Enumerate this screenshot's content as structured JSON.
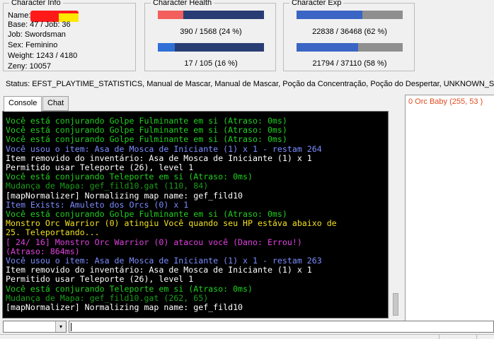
{
  "character_info": {
    "title": "Character Info",
    "name_label": "Name:",
    "base_job": "Base: 47 / Job: 36",
    "job": "Job: Swordsman",
    "sex": "Sex: Feminino",
    "weight": "Weight: 1243 / 4180",
    "zeny": "Zeny: 10057"
  },
  "character_health": {
    "title": "Character Health",
    "hp_text": "390 / 1568 (24 %)",
    "hp_fraction": 0.24,
    "sp_text": "17 / 105 (16 %)",
    "sp_fraction": 0.16
  },
  "character_exp": {
    "title": "Character Exp",
    "base_text": "22838 / 36468 (62 %)",
    "base_fraction": 0.62,
    "job_text": "21794 / 37110 (58 %)",
    "job_fraction": 0.58
  },
  "colors": {
    "hp": "#f25f5c",
    "sp": "#2f6fd6",
    "exp": "#3a65c4",
    "bar_bg": "#293d75",
    "exp_bg": "#8f8f8f",
    "green": "#1fd11f",
    "cyan_blue": "#7c8cff",
    "white": "#ffffff",
    "yellow": "#f0e020",
    "magenta": "#e040e0",
    "dark_green": "#1a9c1a"
  },
  "status": "Status: EFST_PLAYTIME_STATISTICS, Manual de Mascar, Manual de Mascar, Poção da Concentração, Poção do Despertar, UNKNOWN_STA",
  "tabs": [
    {
      "label": "Console",
      "active": true
    },
    {
      "label": "Chat",
      "active": false
    }
  ],
  "console_lines": [
    {
      "text": "Você está conjurando Golpe Fulminante em si (Atraso: 0ms)",
      "color": "#1fd11f"
    },
    {
      "text": "Você está conjurando Golpe Fulminante em si (Atraso: 0ms)",
      "color": "#1fd11f"
    },
    {
      "text": "Você está conjurando Golpe Fulminante em si (Atraso: 0ms)",
      "color": "#1fd11f"
    },
    {
      "text": "Você usou o item: Asa de Mosca de Iniciante (1) x 1 - restam 264",
      "color": "#7c8cff"
    },
    {
      "text": "Item removido do inventário: Asa de Mosca de Iniciante (1) x 1",
      "color": "#ffffff"
    },
    {
      "text": "Permitido usar Teleporte (26), level 1",
      "color": "#ffffff"
    },
    {
      "text": "Você está conjurando Teleporte em si (Atraso: 0ms)",
      "color": "#1fd11f"
    },
    {
      "text": "Mudança de Mapa: gef_fild10.gat (110, 84)",
      "color": "#1a9c1a"
    },
    {
      "text": "[mapNormalizer] Normalizing map name: gef_fild10",
      "color": "#ffffff"
    },
    {
      "text": "Item Exists: Amuleto dos Orcs (0) x 1",
      "color": "#7c8cff"
    },
    {
      "text": "Você está conjurando Golpe Fulminante em si (Atraso: 0ms)",
      "color": "#1fd11f"
    },
    {
      "text": "Monstro Orc Warrior (0) atingiu Você quando seu HP estáva abaixo de",
      "color": "#f0e020"
    },
    {
      "text": "25. Teleportando...",
      "color": "#f0e020"
    },
    {
      "text": "[ 24/ 16] Monstro Orc Warrior (0) atacou você (Dano: Errou!)",
      "color": "#e040e0"
    },
    {
      "text": "(Atraso: 864ms)",
      "color": "#e040e0"
    },
    {
      "text": "Você usou o item: Asa de Mosca de Iniciante (1) x 1 - restam 263",
      "color": "#7c8cff"
    },
    {
      "text": "Item removido do inventário: Asa de Mosca de Iniciante (1) x 1",
      "color": "#ffffff"
    },
    {
      "text": "Permitido usar Teleporte (26), level 1",
      "color": "#ffffff"
    },
    {
      "text": "Você está conjurando Teleporte em si (Atraso: 0ms)",
      "color": "#1fd11f"
    },
    {
      "text": "Mudança de Mapa: gef_fild10.gat (262, 65)",
      "color": "#1a9c1a"
    },
    {
      "text": "[mapNormalizer] Normalizing map name: gef_fild10",
      "color": "#ffffff"
    }
  ],
  "monster_list": [
    {
      "text": "0   Orc Baby (255, 53 )"
    }
  ],
  "icons": {
    "combo_arrow": "▾"
  }
}
